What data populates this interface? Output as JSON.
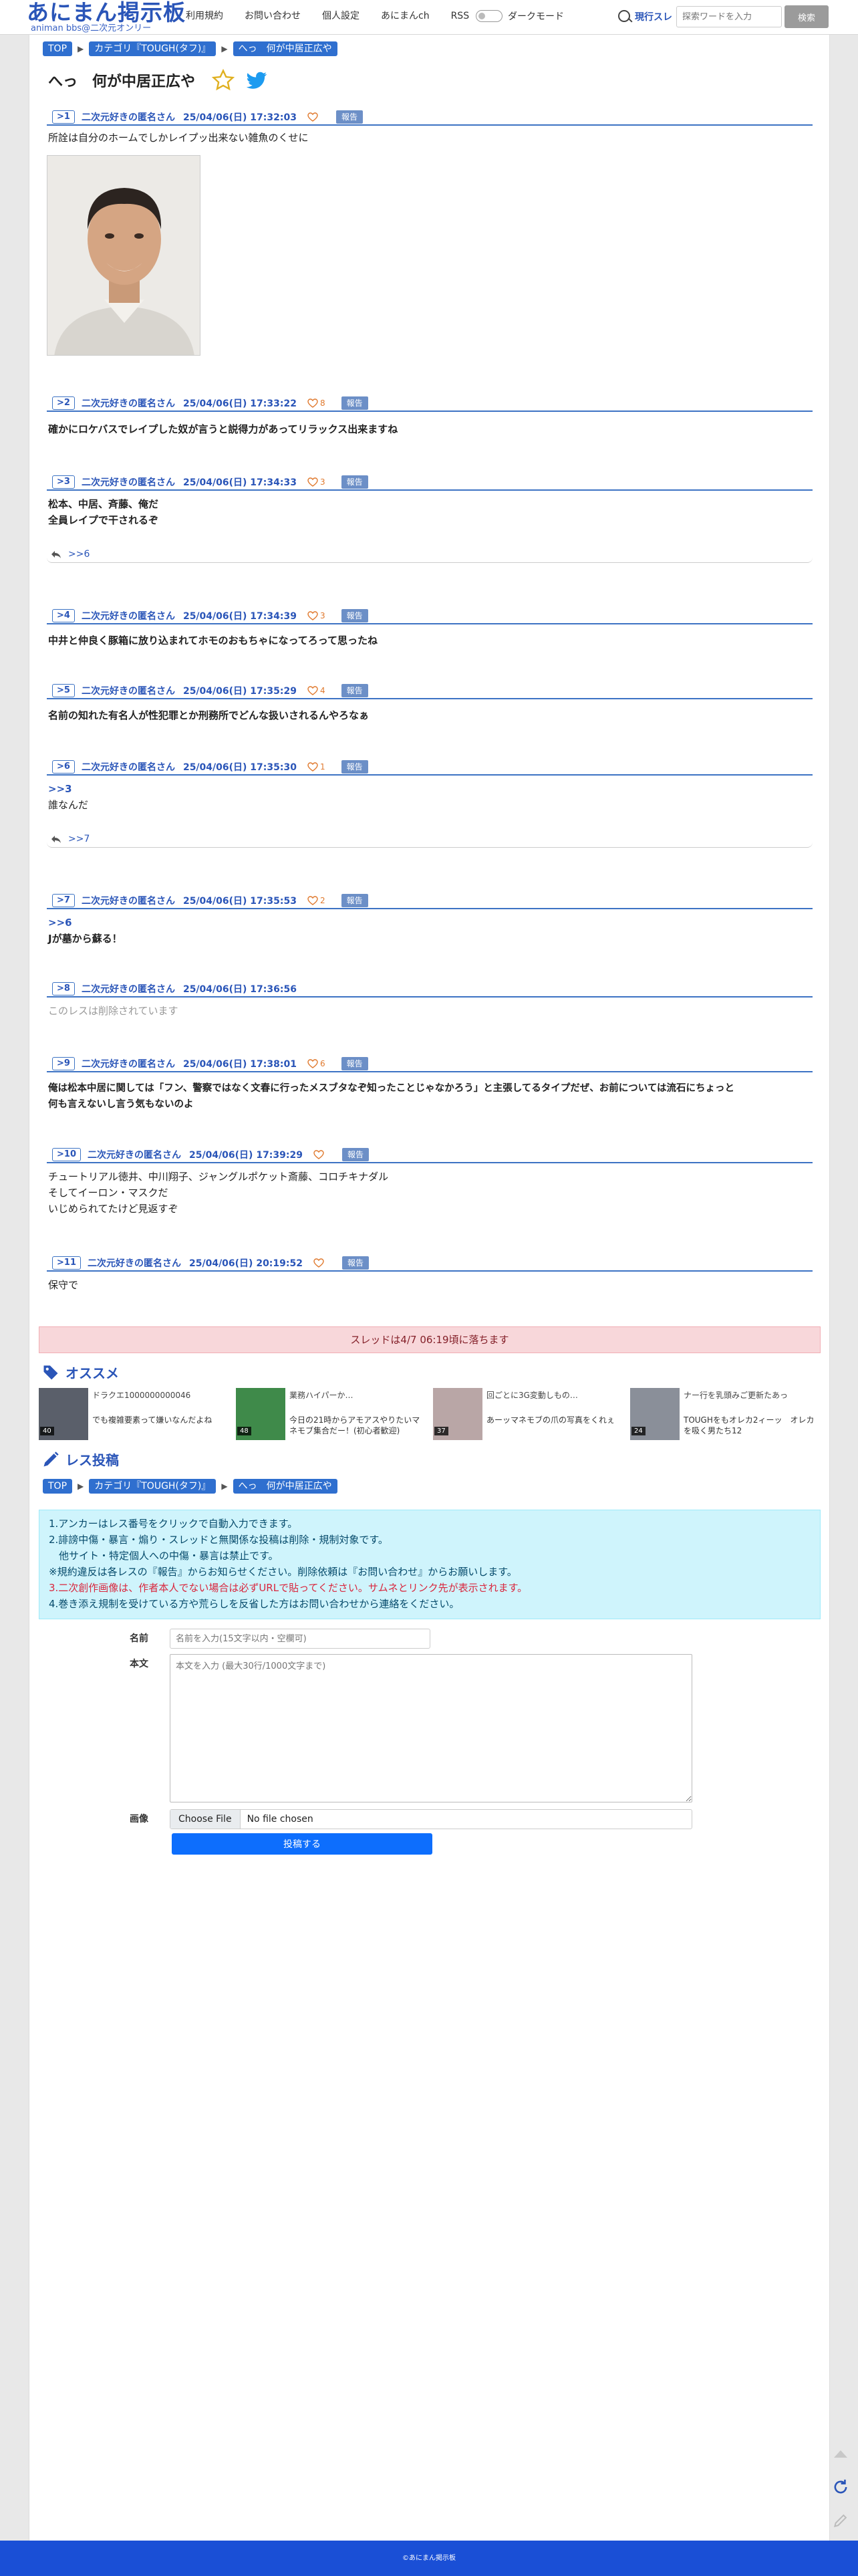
{
  "header": {
    "logo_main": "あにまん掲示板",
    "logo_sub": "animan bbs@二次元オンリー",
    "nav": [
      "利用規約",
      "お問い合わせ",
      "個人設定",
      "あにまんch",
      "RSS"
    ],
    "dark_mode_label": "ダークモード",
    "search_scope": "現行スレ",
    "search_placeholder": "探索ワードを入力",
    "search_button": "検索"
  },
  "breadcrumb": [
    "TOP",
    "カテゴリ『TOUGH(タフ)』",
    "へっ　何が中居正広や"
  ],
  "thread_title": "へっ　何が中居正広や",
  "posts": [
    {
      "num": ">1",
      "name": "二次元好きの匿名さん",
      "date": "25/04/06(日) 17:32:03",
      "likes": "",
      "report": "報告",
      "body": "所詮は自分のホームでしかレイプッ出来ない雑魚のくせに"
    },
    {
      "num": ">2",
      "name": "二次元好きの匿名さん",
      "date": "25/04/06(日) 17:33:22",
      "likes": "8",
      "report": "報告",
      "body": "確かにロケバスでレイプした奴が言うと説得力があってリラックス出来ますね"
    },
    {
      "num": ">3",
      "name": "二次元好きの匿名さん",
      "date": "25/04/06(日) 17:34:33",
      "likes": "3",
      "report": "報告",
      "body1": "松本、中居、斉藤、俺だ",
      "body2": "全員レイプで干されるぞ",
      "reply": ">>6"
    },
    {
      "num": ">4",
      "name": "二次元好きの匿名さん",
      "date": "25/04/06(日) 17:34:39",
      "likes": "3",
      "report": "報告",
      "body": "中井と仲良く豚箱に放り込まれてホモのおもちゃになってろって思ったね"
    },
    {
      "num": ">5",
      "name": "二次元好きの匿名さん",
      "date": "25/04/06(日) 17:35:29",
      "likes": "4",
      "report": "報告",
      "body": "名前の知れた有名人が性犯罪とか刑務所でどんな扱いされるんやろなぁ"
    },
    {
      "num": ">6",
      "name": "二次元好きの匿名さん",
      "date": "25/04/06(日) 17:35:30",
      "likes": "1",
      "report": "報告",
      "anchor": ">>3",
      "body": "誰なんだ",
      "reply": ">>7"
    },
    {
      "num": ">7",
      "name": "二次元好きの匿名さん",
      "date": "25/04/06(日) 17:35:53",
      "likes": "2",
      "report": "報告",
      "anchor": ">>6",
      "body": "Jが墓から蘇る！"
    },
    {
      "num": ">8",
      "name": "二次元好きの匿名さん",
      "date": "25/04/06(日) 17:36:56",
      "likes": "",
      "report": "",
      "body": "このレスは削除されています"
    },
    {
      "num": ">9",
      "name": "二次元好きの匿名さん",
      "date": "25/04/06(日) 17:38:01",
      "likes": "6",
      "report": "報告",
      "body1": "俺は松本中居に関しては「フン、警察ではなく文春に行ったメスブタなぞ知ったことじゃなかろう」と主張してるタイプだぜ、お前については流石にちょっと",
      "body2": "何も言えないし言う気もないのよ"
    },
    {
      "num": ">10",
      "name": "二次元好きの匿名さん",
      "date": "25/04/06(日) 17:39:29",
      "likes": "",
      "report": "報告",
      "body1": "チュートリアル徳井、中川翔子、ジャングルポケット斎藤、コロチキナダル",
      "body2": "そしてイーロン・マスクだ",
      "body3": "いじめられてたけど見返すぞ"
    },
    {
      "num": ">11",
      "name": "二次元好きの匿名さん",
      "date": "25/04/06(日) 20:19:52",
      "likes": "",
      "report": "報告",
      "body": "保守で"
    }
  ],
  "thread_notice": "スレッドは4/7 06:19頃に落ちます",
  "recommend": {
    "title": "オススメ",
    "items": [
      {
        "title": "ドラクエ1000000000046",
        "desc": "でも複雑要素って嫌いなんだよね",
        "count": "40"
      },
      {
        "title": "業務ハイパーか…",
        "desc": "今日の21時からアモアスやりたいマネモブ集合だー！(初心者歓迎)",
        "count": "48"
      },
      {
        "title": "回ごとに3G変動しもの…",
        "desc": "あーッマネモブの爪の写真をくれぇ",
        "count": "37"
      },
      {
        "title": "ナー行を乳頭みご更新たあっ",
        "desc": "TOUGHをもオレカ2ィーッ　オレカを吸く男たち12",
        "count": "24"
      }
    ]
  },
  "post_form": {
    "title": "レス投稿",
    "rules": [
      "1.アンカーはレス番号をクリックで自動入力できます。",
      "2.誹謗中傷・暴言・煽り・スレッドと無関係な投稿は削除・規制対象です。",
      "　他サイト・特定個人への中傷・暴言は禁止です。",
      "※規約違反は各レスの『報告』からお知らせください。削除依頼は『お問い合わせ』からお願いします。",
      "3.二次創作画像は、作者本人でない場合は必ずURLで貼ってください。サムネとリンク先が表示されます。",
      "4.巻き添え規制を受けている方や荒らしを反省した方はお問い合わせから連絡をください。"
    ],
    "name_label": "名前",
    "name_placeholder": "名前を入力(15文字以内・空欄可)",
    "body_label": "本文",
    "body_placeholder": "本文を入力 (最大30行/1000文字まで)",
    "image_label": "画像",
    "file_button": "Choose File",
    "file_name": "No file chosen",
    "submit": "投稿する"
  },
  "footer": "©あにまん掲示板",
  "colors": {
    "brand": "#2a55b8",
    "crumb": "#2f6fcf",
    "footer": "#1a4fd6",
    "submit": "#0d6efd"
  }
}
